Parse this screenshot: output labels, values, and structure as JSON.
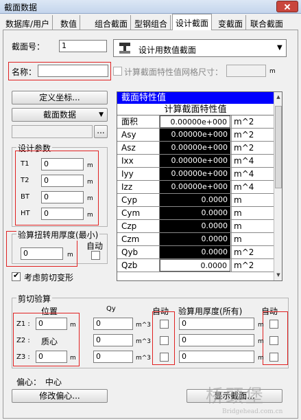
{
  "window": {
    "title": "截面数据"
  },
  "tabs": [
    "数据库/用户",
    "数值",
    "组合截面",
    "型钢组合",
    "设计截面",
    "变截面",
    "联合截面"
  ],
  "section_number": {
    "label": "截面号：",
    "value": "1"
  },
  "section_type": {
    "selected": "设计用数值截面"
  },
  "name": {
    "label": "名称：",
    "value": ""
  },
  "mesh": {
    "label": "计算截面特性值网格尺寸：",
    "value": "",
    "unit": "m"
  },
  "buttons": {
    "define_coord": "定义坐标...",
    "section_data": "截面数据",
    "browse": "...",
    "modify_offset": "修改偏心...",
    "show_section": "显示截面..."
  },
  "design_params": {
    "title": "设计参数",
    "rows": [
      {
        "label": "T1",
        "value": "0",
        "unit": "m"
      },
      {
        "label": "T2",
        "value": "0",
        "unit": "m"
      },
      {
        "label": "BT",
        "value": "0",
        "unit": "m"
      },
      {
        "label": "HT",
        "value": "0",
        "unit": "m"
      }
    ]
  },
  "torsion": {
    "title": "验算扭转用厚度(最小)",
    "value": "0",
    "unit": "m",
    "auto_label": "自动"
  },
  "shear_deform": {
    "label": "考虑剪切变形",
    "checked": true
  },
  "properties": {
    "title": "截面特性值",
    "subtitle": "计算截面特性值",
    "rows": [
      {
        "name": "面积",
        "value": "0.00000e+000",
        "unit": "m^2",
        "dark": false
      },
      {
        "name": "Asy",
        "value": "0.00000e+000",
        "unit": "m^2",
        "dark": true
      },
      {
        "name": "Asz",
        "value": "0.00000e+000",
        "unit": "m^2",
        "dark": true
      },
      {
        "name": "Ixx",
        "value": "0.00000e+000",
        "unit": "m^4",
        "dark": true
      },
      {
        "name": "Iyy",
        "value": "0.00000e+000",
        "unit": "m^4",
        "dark": true
      },
      {
        "name": "Izz",
        "value": "0.00000e+000",
        "unit": "m^4",
        "dark": true
      },
      {
        "name": "Cyp",
        "value": "0.0000",
        "unit": "m",
        "dark": true
      },
      {
        "name": "Cym",
        "value": "0.0000",
        "unit": "m",
        "dark": true
      },
      {
        "name": "Czp",
        "value": "0.0000",
        "unit": "m",
        "dark": true
      },
      {
        "name": "Czm",
        "value": "0.0000",
        "unit": "m",
        "dark": true
      },
      {
        "name": "Qyb",
        "value": "0.0000",
        "unit": "m^2",
        "dark": true
      },
      {
        "name": "Qzb",
        "value": "0.0000",
        "unit": "m^2",
        "dark": false
      }
    ]
  },
  "shear": {
    "title": "剪切验算",
    "headers": {
      "position": "位置",
      "qy": "Qy",
      "auto1": "自动",
      "thickness": "验算用厚度(所有)",
      "auto2": "自动"
    },
    "rows": [
      {
        "label": "Z1 :",
        "pos": "0",
        "pos_unit": "m",
        "qy": "0",
        "qy_unit": "m^3",
        "thick": "0",
        "thick_unit": "m"
      },
      {
        "label": "Z2 :",
        "pos_text": "质心",
        "qy": "0",
        "qy_unit": "m^3",
        "thick": "0",
        "thick_unit": "m"
      },
      {
        "label": "Z3 :",
        "pos": "0",
        "pos_unit": "m",
        "qy": "0",
        "qy_unit": "m^3",
        "thick": "0",
        "thick_unit": "m"
      }
    ]
  },
  "offset": {
    "label": "偏心：",
    "value": "中心"
  },
  "watermark": {
    "logo": "桥頭堡",
    "url": "Bridgehead.com.cn"
  }
}
